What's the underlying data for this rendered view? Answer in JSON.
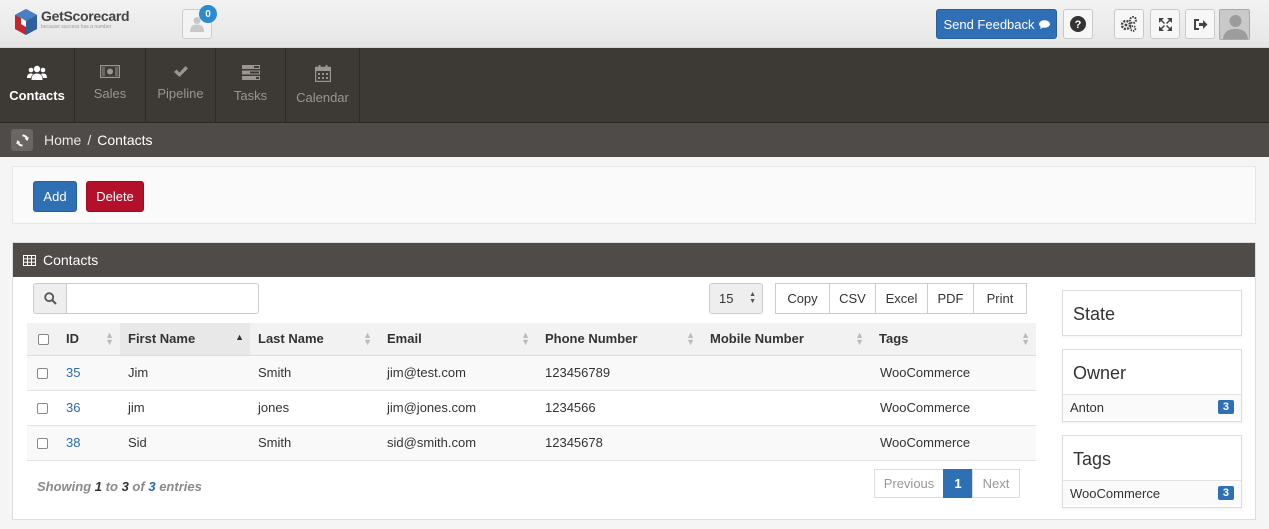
{
  "header": {
    "logo_name": "GetScorecard",
    "logo_tagline": "because success has a number",
    "notification_count": "0",
    "feedback_label": "Send Feedback"
  },
  "nav": [
    {
      "label": "Contacts",
      "icon": "users-icon",
      "active": true
    },
    {
      "label": "Sales",
      "icon": "money-icon",
      "active": false
    },
    {
      "label": "Pipeline",
      "icon": "check-icon",
      "active": false
    },
    {
      "label": "Tasks",
      "icon": "tasks-icon",
      "active": false
    },
    {
      "label": "Calendar",
      "icon": "calendar-icon",
      "active": false
    }
  ],
  "breadcrumb": {
    "home": "Home",
    "separator": "/",
    "current": "Contacts"
  },
  "actions": {
    "add_label": "Add",
    "delete_label": "Delete"
  },
  "panel": {
    "title": "Contacts",
    "search_value": "",
    "page_size": "15",
    "export_buttons": [
      "Copy",
      "CSV",
      "Excel",
      "PDF",
      "Print"
    ]
  },
  "table": {
    "columns": [
      "ID",
      "First Name",
      "Last Name",
      "Email",
      "Phone Number",
      "Mobile Number",
      "Tags"
    ],
    "sorted_column": "First Name",
    "rows": [
      {
        "id": "35",
        "first": "Jim",
        "last": "Smith",
        "email": "jim@test.com",
        "phone": "123456789",
        "mobile": "",
        "tags": "WooCommerce"
      },
      {
        "id": "36",
        "first": "jim",
        "last": "jones",
        "email": "jim@jones.com",
        "phone": "1234566",
        "mobile": "",
        "tags": "WooCommerce"
      },
      {
        "id": "38",
        "first": "Sid",
        "last": "Smith",
        "email": "sid@smith.com",
        "phone": "12345678",
        "mobile": "",
        "tags": "WooCommerce"
      }
    ]
  },
  "info": {
    "showing": "Showing",
    "from": "1",
    "to_word": "to",
    "to": "3",
    "of_word": "of",
    "total": "3",
    "entries": "entries"
  },
  "pager": {
    "previous": "Previous",
    "current": "1",
    "next": "Next"
  },
  "facets": {
    "state": {
      "title": "State"
    },
    "owner": {
      "title": "Owner",
      "items": [
        {
          "label": "Anton",
          "count": "3"
        }
      ]
    },
    "tags": {
      "title": "Tags",
      "items": [
        {
          "label": "WooCommerce",
          "count": "3"
        }
      ]
    }
  },
  "colors": {
    "primary": "#2f70b5",
    "danger": "#b5102b",
    "nav_bg": "#3d3935",
    "panel_head": "#4e4b48"
  }
}
